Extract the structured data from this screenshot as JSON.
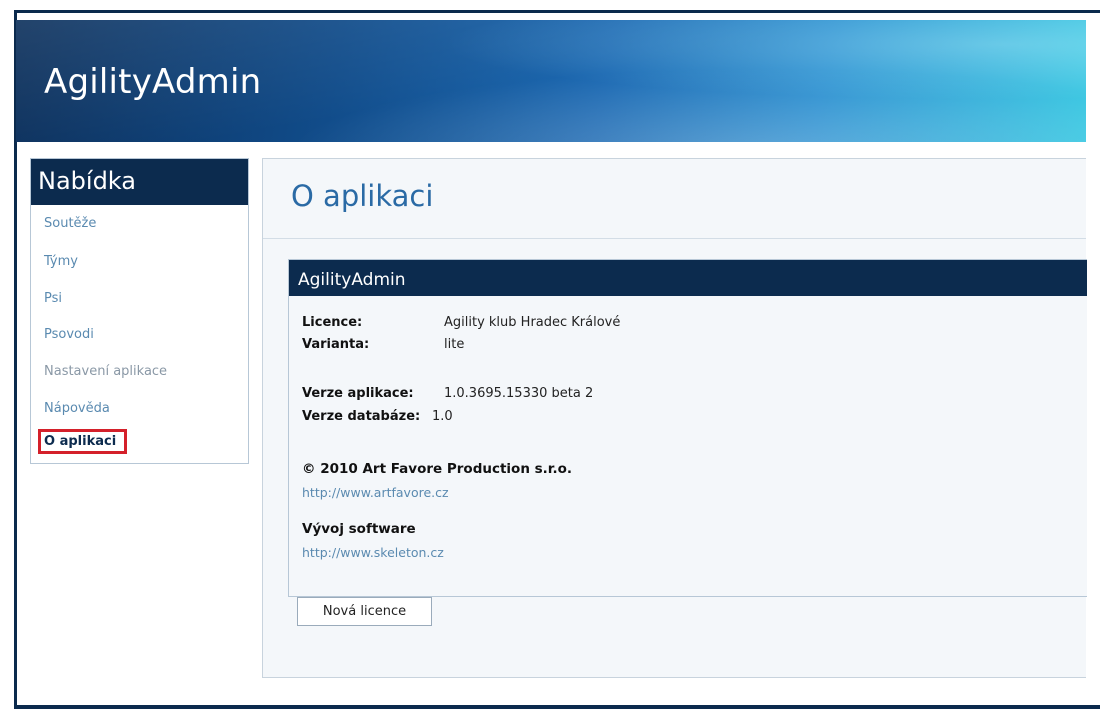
{
  "app": {
    "title": "AgilityAdmin"
  },
  "sidebar": {
    "heading": "Nabídka",
    "items": [
      {
        "label": "Soutěže"
      },
      {
        "label": "Týmy"
      },
      {
        "label": "Psi"
      },
      {
        "label": "Psovodi"
      },
      {
        "label": "Nastavení aplikace"
      },
      {
        "label": "Nápověda"
      },
      {
        "label": "O aplikaci"
      }
    ]
  },
  "main": {
    "page_title": "O aplikaci",
    "panel": {
      "heading": "AgilityAdmin",
      "licence_label": "Licence:",
      "licence_value": "Agility klub Hradec Králové",
      "varianta_label": "Varianta:",
      "varianta_value": "lite",
      "app_version_label": "Verze aplikace:",
      "app_version_value": "1.0.3695.15330 beta 2",
      "db_version_label": "Verze databáze:",
      "db_version_value": "1.0",
      "copyright": "© 2010 Art Favore Production s.r.o.",
      "copyright_link": "http://www.artfavore.cz",
      "dev_heading": "Vývoj software",
      "dev_link": "http://www.skeleton.cz",
      "new_licence_button": "Nová licence"
    }
  },
  "colors": {
    "navy": "#0c2b4e",
    "link": "#5a8ab0",
    "title_blue": "#2a6aa5",
    "highlight_red": "#d4202a"
  }
}
